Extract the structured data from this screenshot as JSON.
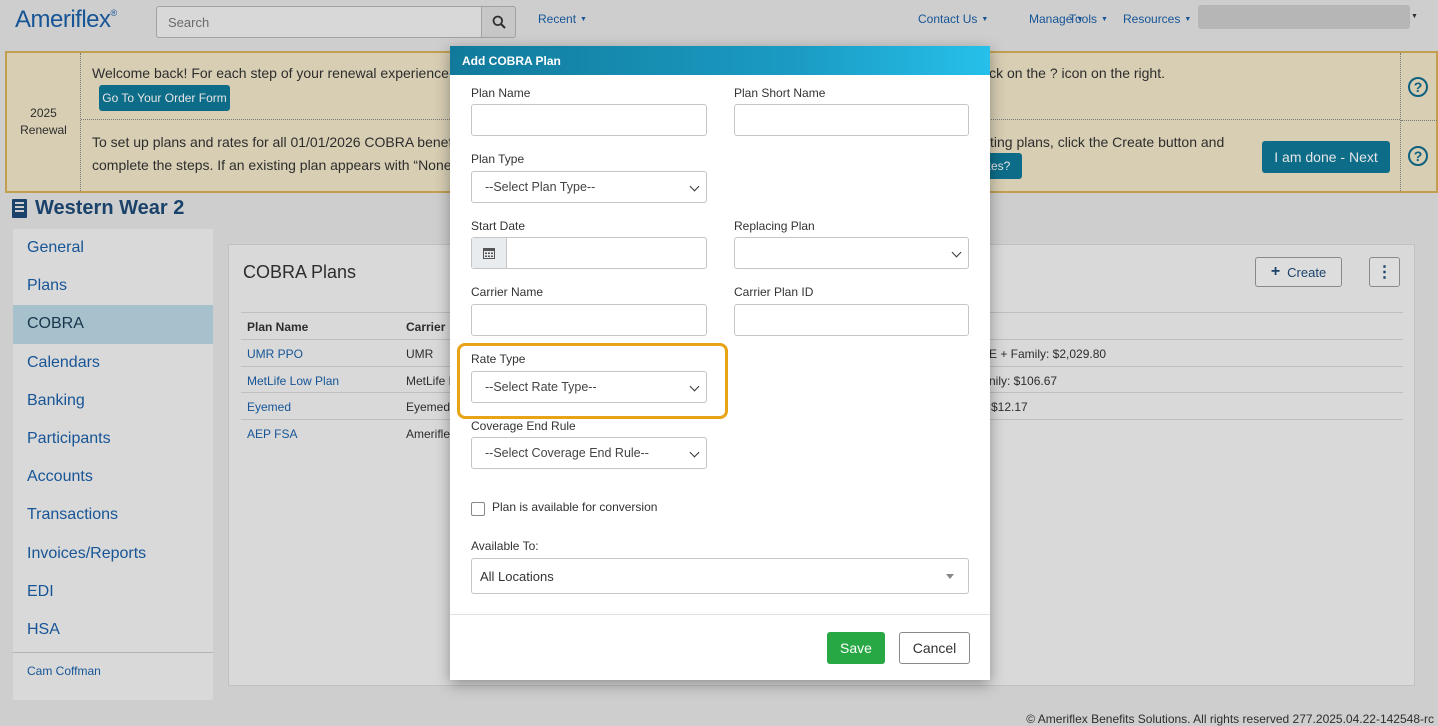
{
  "nav": {
    "logo": "Ameriflex",
    "logo_mark": "®",
    "search_placeholder": "Search",
    "recent": "Recent",
    "contact": "Contact Us",
    "manage": "Manage",
    "tools": "Tools",
    "resources": "Resources"
  },
  "banner": {
    "year": "2025",
    "renewal": "Renewal",
    "welcome": "Welcome back! For each step of your renewal experience, y",
    "welcome_right": "ick on the ? icon on the right.",
    "order_form_button": "Go To Your Order Form",
    "setup_line1": "To set up plans and rates for all 01/01/2026 COBRA benefit",
    "setup_line2": "complete the steps. If an existing plan appears with “None”",
    "setup_right": "ting plans, click the Create button and",
    "rates_button": "tes?",
    "done_button": "I am done - Next",
    "help_glyph": "?"
  },
  "company": {
    "name": "Western Wear 2"
  },
  "sidebar": {
    "items": [
      "General",
      "Plans",
      "COBRA",
      "Calendars",
      "Banking",
      "Participants",
      "Accounts",
      "Transactions",
      "Invoices/Reports",
      "EDI",
      "HSA"
    ],
    "active": "COBRA",
    "user": "Cam Coffman"
  },
  "panel": {
    "title": "COBRA Plans",
    "create_button": "Create",
    "create_icon": "+",
    "kebab_icon": "⋮",
    "columns": {
      "plan_name": "Plan Name",
      "carrier": "Carrier"
    },
    "rows": [
      {
        "plan": "UMR PPO",
        "carrier": "UMR",
        "rates": "E + Family: $2,029.80"
      },
      {
        "plan": "MetLife Low Plan",
        "carrier": "MetLife L",
        "rates": "nily: $106.67"
      },
      {
        "plan": "Eyemed",
        "carrier": "Eyemed",
        "rates": "$12.17"
      },
      {
        "plan": "AEP FSA",
        "carrier": "Ameriflex",
        "rates": ""
      }
    ]
  },
  "modal": {
    "title": "Add COBRA Plan",
    "plan_name_label": "Plan Name",
    "plan_short_name_label": "Plan Short Name",
    "plan_type_label": "Plan Type",
    "plan_type_value": "--Select Plan Type--",
    "start_date_label": "Start Date",
    "replacing_plan_label": "Replacing Plan",
    "carrier_name_label": "Carrier Name",
    "carrier_plan_id_label": "Carrier Plan ID",
    "rate_type_label": "Rate Type",
    "rate_type_value": "--Select Rate Type--",
    "coverage_end_rule_label": "Coverage End Rule",
    "coverage_end_rule_value": "--Select Coverage End Rule--",
    "conversion_label": "Plan is available for conversion",
    "available_to_label": "Available To:",
    "available_to_value": "All Locations",
    "save_button": "Save",
    "cancel_button": "Cancel"
  },
  "footer": {
    "text": "© Ameriflex Benefits Solutions. All rights reserved 277.2025.04.22-142548-rc"
  },
  "colors": {
    "brand": "#1a5fa8",
    "teal": "#0f7a99",
    "highlight": "#e8a317",
    "save": "#28a745",
    "banner_bg": "#f0e6c8",
    "active_nav": "#b9d7e2"
  }
}
